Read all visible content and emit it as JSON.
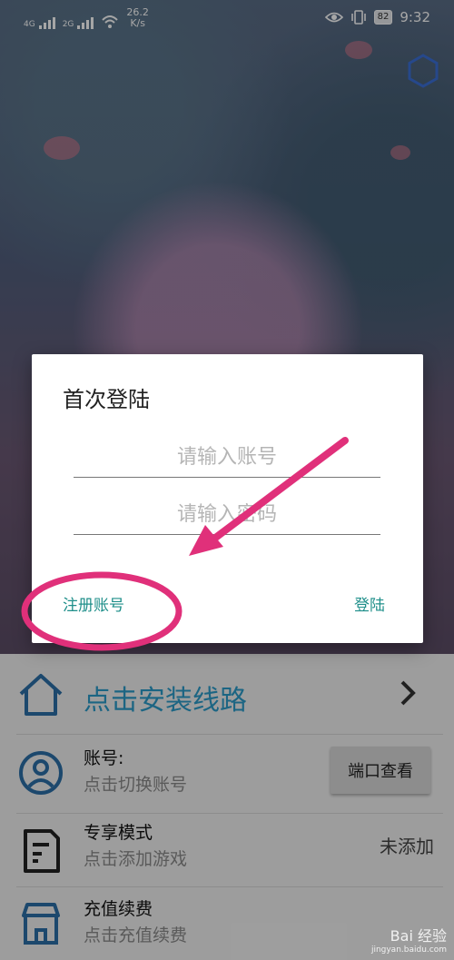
{
  "status_bar": {
    "sim1": "4G",
    "sim2": "2G",
    "speed_value": "26.2",
    "speed_unit": "K/s",
    "battery": "82",
    "time": "9:32"
  },
  "dialog": {
    "title": "首次登陆",
    "account_placeholder": "请输入账号",
    "password_placeholder": "请输入密码",
    "register_label": "注册账号",
    "login_label": "登陆"
  },
  "panel": {
    "install_route": "点击安装线路",
    "account_title": "账号:",
    "account_sub": "点击切换账号",
    "port_button": "端口查看",
    "exclusive_title": "专享模式",
    "exclusive_sub": "点击添加游戏",
    "exclusive_status": "未添加",
    "recharge_title": "充值续费",
    "recharge_sub": "点击充值续费"
  },
  "watermark": {
    "main": "Bai 经验",
    "sub": "jingyan.baidu.com"
  },
  "colors": {
    "accent": "#2b9bc9",
    "dialog_button": "#1f8f8a",
    "annotation": "#e0307a"
  }
}
